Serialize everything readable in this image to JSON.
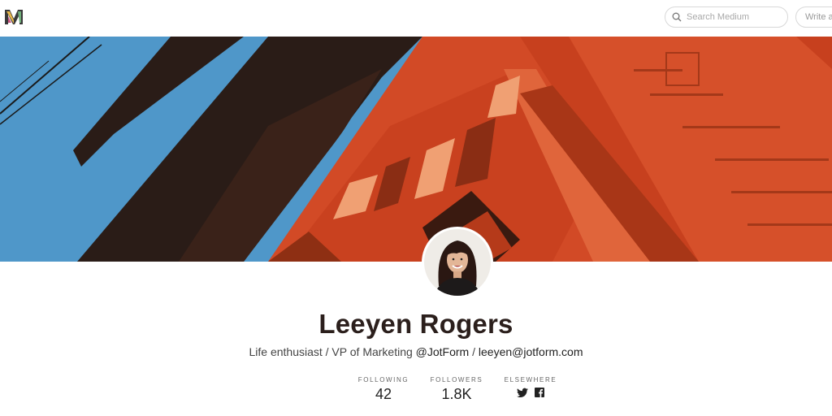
{
  "header": {
    "search_placeholder": "Search Medium",
    "write_label": "Write a story"
  },
  "profile": {
    "name": "Leeyen Rogers",
    "bio_text": "Life enthusiast / VP of Marketing ",
    "bio_company_link": "@JotForm",
    "bio_separator": " / ",
    "bio_email_link": "leeyen@jotform.com"
  },
  "stats": {
    "following_label": "FOLLOWING",
    "following_value": "42",
    "followers_label": "FOLLOWERS",
    "followers_value": "1.8K",
    "elsewhere_label": "ELSEWHERE"
  },
  "icons": {
    "logo": "medium-logo-icon",
    "search": "search-icon",
    "twitter": "twitter-icon",
    "facebook": "facebook-icon"
  },
  "colors": {
    "sky": "#4f97c9",
    "bridge_orange": "#d24a26",
    "bridge_dark": "#2a1c17",
    "name_color": "#2b1f1c"
  }
}
